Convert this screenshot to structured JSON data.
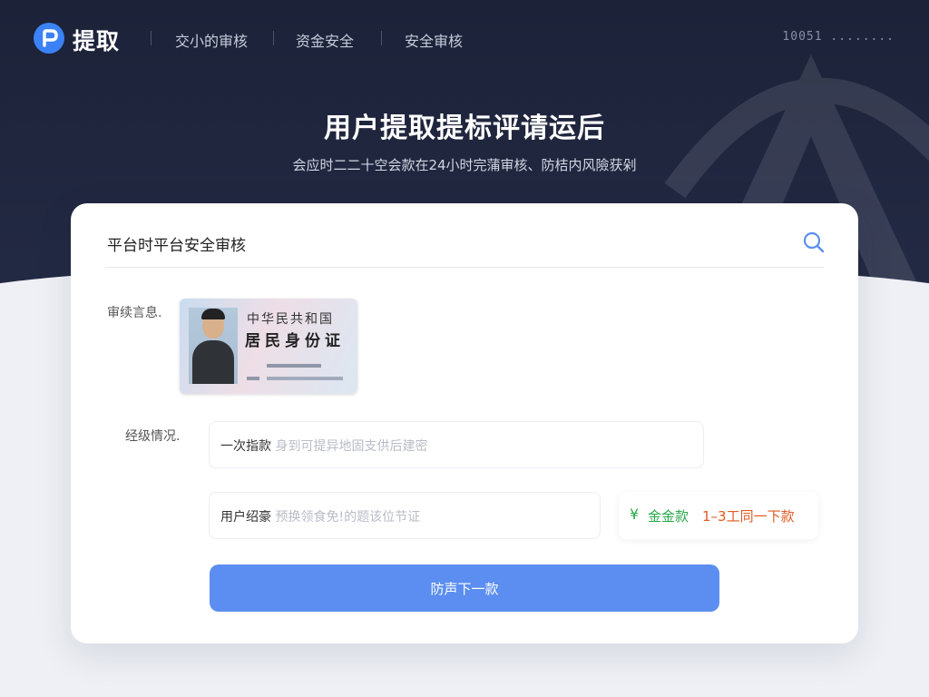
{
  "header": {
    "logo_text": "提取",
    "nav_items": [
      "交小的审核",
      "资金安全",
      "安全审核"
    ],
    "right_text": "10051 ........"
  },
  "hero": {
    "title": "用户提取提标评请运后",
    "subtitle": "会应时二二十空会款在24小时完蒲审核、防桔内风險获剁"
  },
  "card": {
    "title": "平台时平台安全审核",
    "audit_label": "审续言息.",
    "id_card": {
      "line1": "中华民共和国",
      "line2": "居民身份证"
    },
    "status_label": "经级情况.",
    "field1": {
      "label": "一次指款",
      "placeholder": "身到可提异地固支供后建密"
    },
    "field2": {
      "label": "用户绍豪",
      "placeholder": "预换领食免!的题该位节证"
    },
    "info": {
      "yen": "¥",
      "green_text": "金金款",
      "orange_text": "1–3工同一下款"
    },
    "submit_label": "防声下一款"
  },
  "colors": {
    "hero_bg": "#1c2238",
    "accent": "#5b8ef0",
    "green": "#2aa84a",
    "orange": "#e05a22"
  },
  "icons": [
    "logo-icon",
    "search-icon",
    "yen-icon"
  ]
}
